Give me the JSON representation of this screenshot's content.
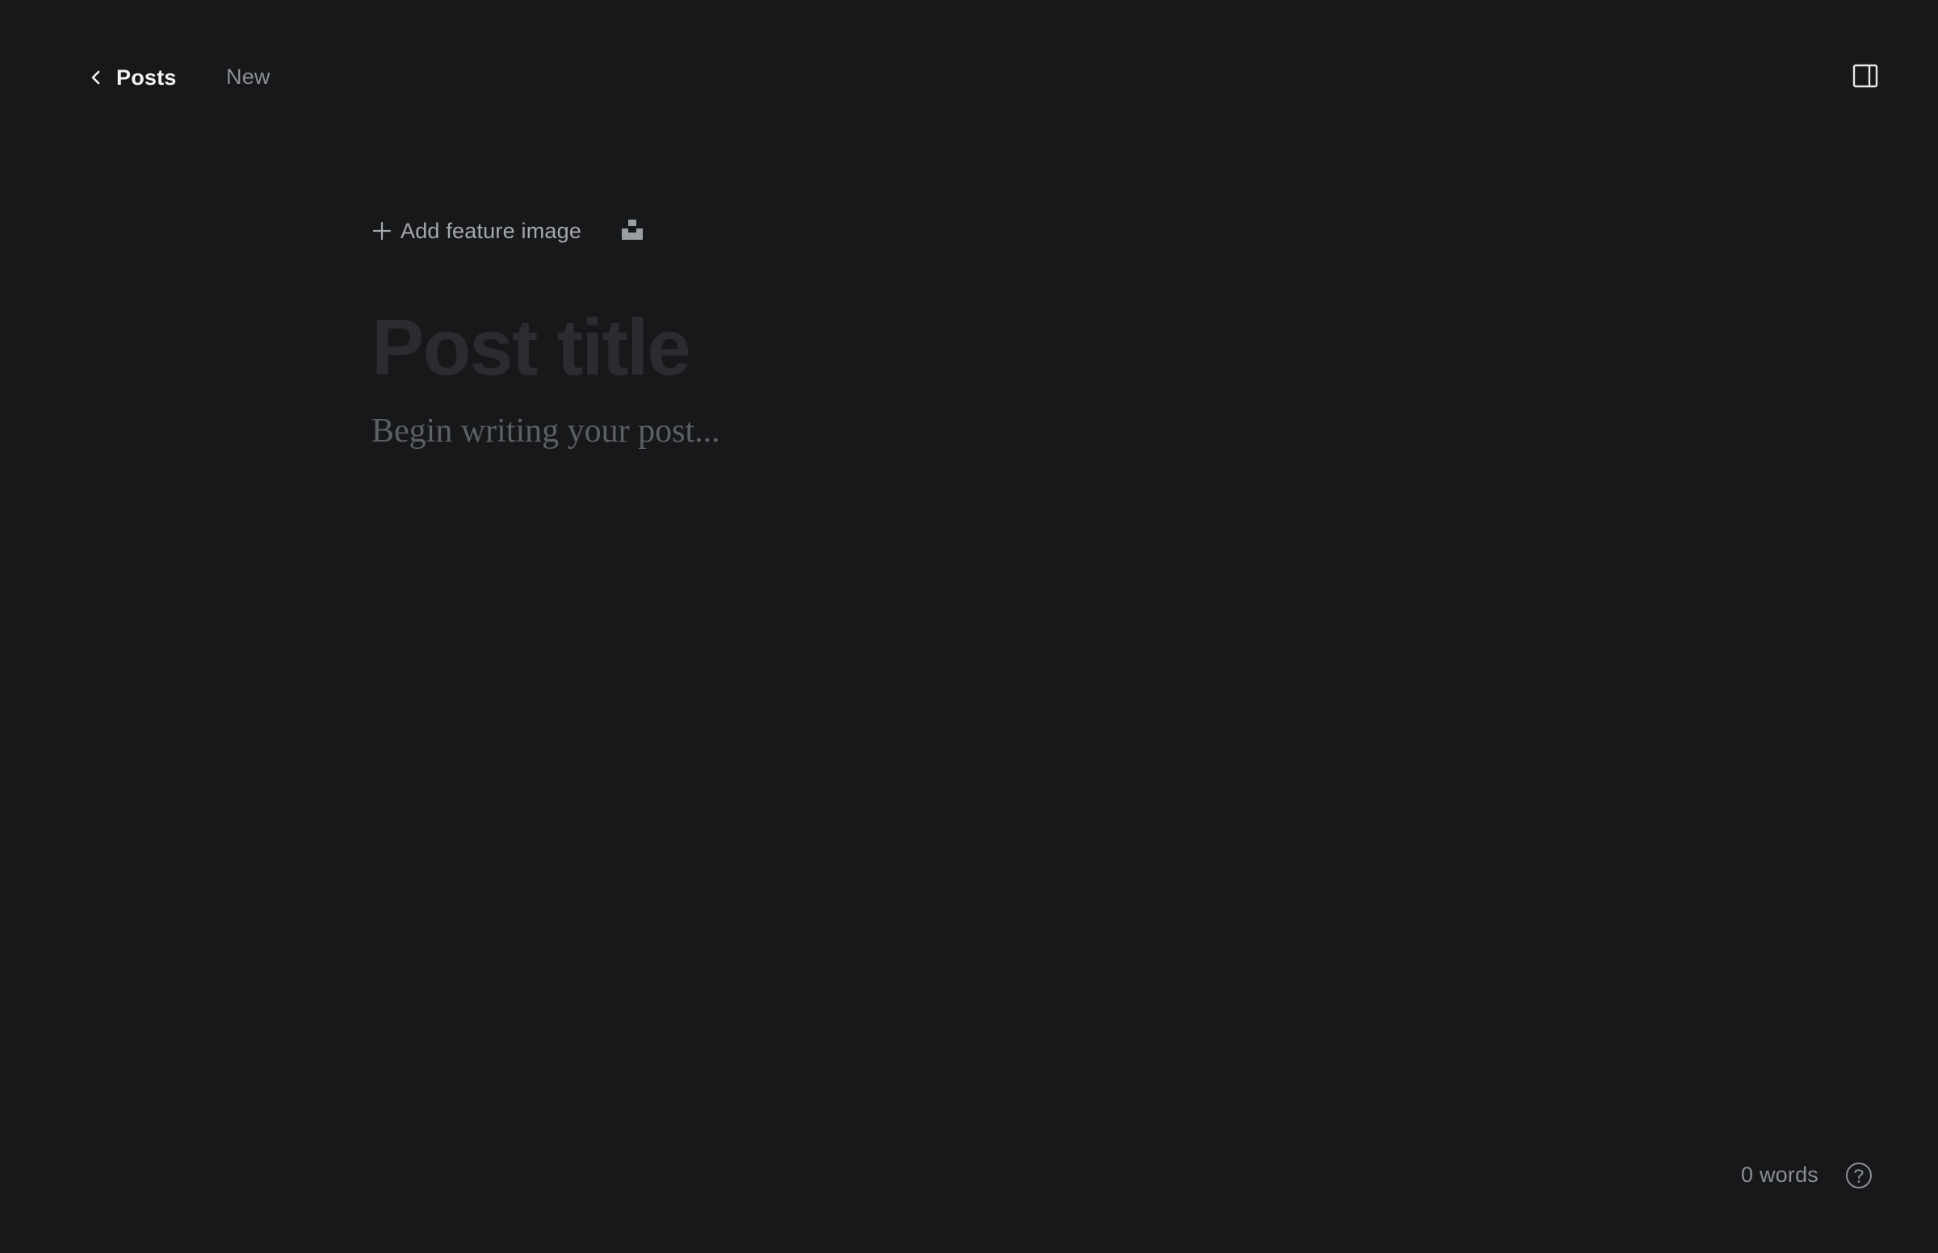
{
  "header": {
    "back_label": "Posts",
    "status": "New",
    "back_icon": "chevron-left-icon",
    "sidebar_toggle_icon": "sidebar-panel-icon"
  },
  "editor": {
    "add_feature_image_label": "Add feature image",
    "add_feature_image_icon": "plus-icon",
    "unsplash_icon": "unsplash-icon",
    "title_placeholder": "Post title",
    "title_value": "",
    "body_placeholder": "Begin writing your post..."
  },
  "footer": {
    "word_count": "0 words",
    "help_icon": "question-circle-icon"
  },
  "colors": {
    "background": "#17181a",
    "primary_text": "#f2f3f4",
    "muted_text": "#8b8e93",
    "title_placeholder": "#2a2c2f",
    "body_placeholder": "#5c5f63"
  }
}
